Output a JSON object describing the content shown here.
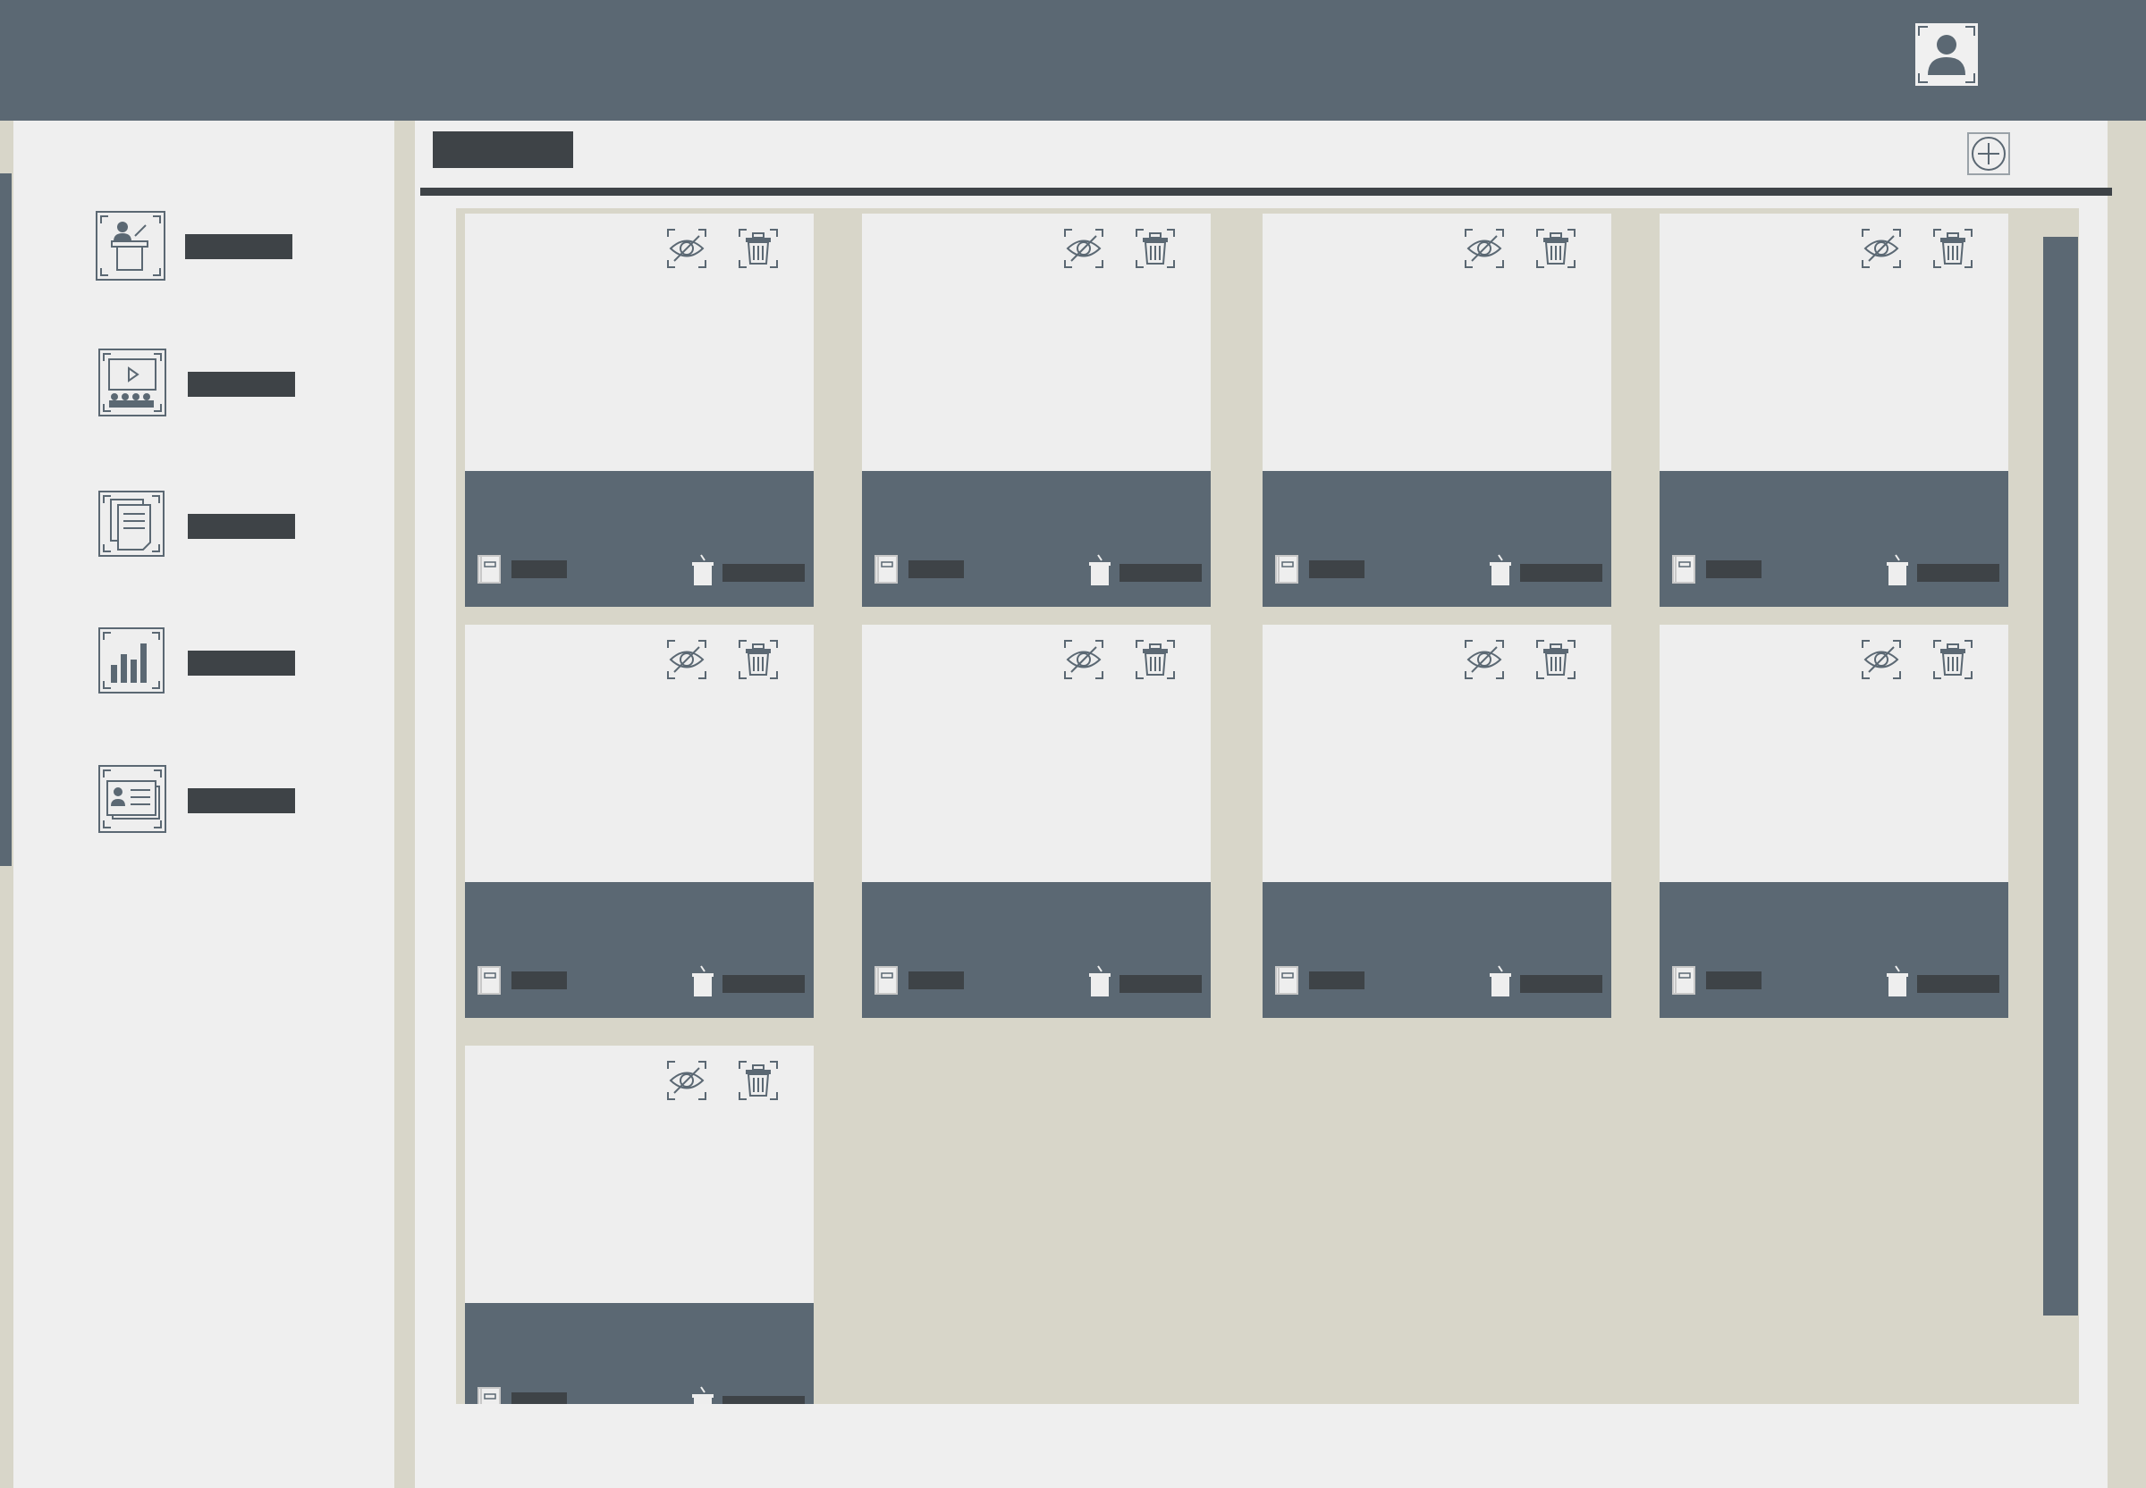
{
  "app": {
    "header": {
      "user_avatar_icon": "user-avatar-icon"
    },
    "sidebar": {
      "items": [
        {
          "icon": "presenter-podium-icon",
          "label": ""
        },
        {
          "icon": "video-audience-icon",
          "label": ""
        },
        {
          "icon": "documents-icon",
          "label": ""
        },
        {
          "icon": "bar-chart-icon",
          "label": ""
        },
        {
          "icon": "id-card-icon",
          "label": ""
        }
      ]
    },
    "main": {
      "title": "",
      "add_button_icon": "plus-circle-icon",
      "cards": [
        {
          "left_label": "",
          "right_label": ""
        },
        {
          "left_label": "",
          "right_label": ""
        },
        {
          "left_label": "",
          "right_label": ""
        },
        {
          "left_label": "",
          "right_label": ""
        },
        {
          "left_label": "",
          "right_label": ""
        },
        {
          "left_label": "",
          "right_label": ""
        },
        {
          "left_label": "",
          "right_label": ""
        },
        {
          "left_label": "",
          "right_label": ""
        },
        {
          "left_label": "",
          "right_label": ""
        }
      ]
    },
    "colors": {
      "header": "#5b6873",
      "panel": "#efefef",
      "background": "#d8d6c9",
      "placeholder_text": "#3e4347"
    }
  }
}
